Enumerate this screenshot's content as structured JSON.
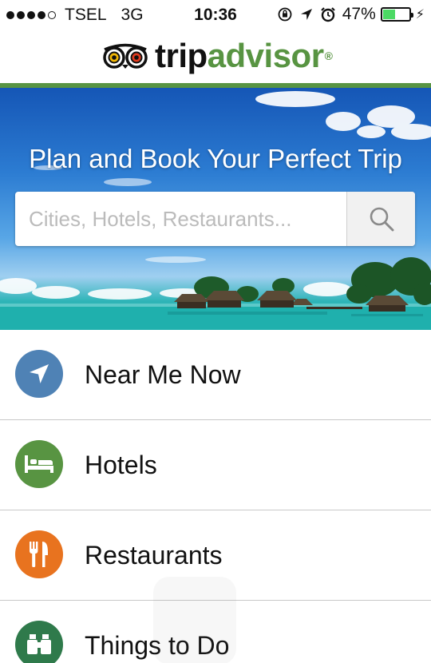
{
  "status_bar": {
    "signal_bars": 4,
    "signal_bars_max": 5,
    "carrier": "TSEL",
    "network": "3G",
    "time": "10:36",
    "icons": [
      "orientation-lock-icon",
      "location-arrow-icon",
      "alarm-clock-icon"
    ],
    "battery_percent": "47%",
    "battery_level": 0.47,
    "battery_color": "#4cd964"
  },
  "header": {
    "logo_icon": "owl-eyes-icon",
    "logo_part1": "trip",
    "logo_part2": "advisor",
    "logo_mark": "®",
    "brand_color": "#589442"
  },
  "hero": {
    "title": "Plan and Book Your Perfect Trip",
    "search": {
      "placeholder": "Cities, Hotels, Restaurants...",
      "value": "",
      "button_icon": "search-icon"
    }
  },
  "menu": {
    "items": [
      {
        "label": "Near Me Now",
        "icon": "location-arrow-icon",
        "color": "#4f82b5"
      },
      {
        "label": "Hotels",
        "icon": "bed-icon",
        "color": "#589442"
      },
      {
        "label": "Restaurants",
        "icon": "fork-knife-icon",
        "color": "#e8731f"
      },
      {
        "label": "Things to Do",
        "icon": "binoculars-icon",
        "color": "#2f7a4b"
      }
    ]
  }
}
